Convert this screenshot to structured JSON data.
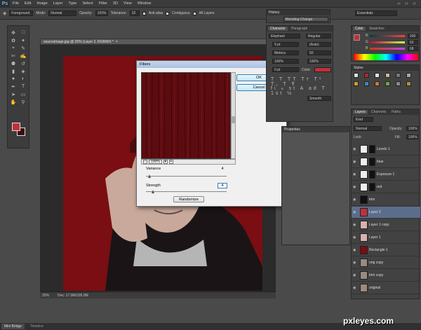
{
  "app": {
    "logo": "Ps"
  },
  "menu": [
    "File",
    "Edit",
    "Image",
    "Layer",
    "Type",
    "Select",
    "Filter",
    "3D",
    "View",
    "Window"
  ],
  "options": {
    "preset": "Foreground",
    "mode_label": "Mode:",
    "mode": "Normal",
    "opacity_label": "Opacity:",
    "opacity": "100%",
    "tolerance_label": "Tolerance:",
    "tolerance": "32",
    "antialias": "Anti-alias",
    "contiguous": "Contiguous",
    "all_layers": "All Layers",
    "workspace": "Essentials"
  },
  "document": {
    "tab": "sourceimage.jpg @ 25% (Layer 2, RGB/8#) *",
    "zoom": "25%",
    "doc_size": "Doc: 17.0M/105.0M"
  },
  "dialog": {
    "title": "Fibers",
    "ok": "OK",
    "cancel": "Cancel",
    "zoom": "100%",
    "variance_label": "Variance",
    "variance": "4",
    "strength_label": "Strength",
    "strength": "4",
    "randomize": "Randomize"
  },
  "history": {
    "title": "History",
    "item": "Blending Change"
  },
  "character": {
    "tabs": [
      "Character",
      "Paragraph"
    ],
    "font": "Elephant",
    "style": "Regular",
    "size": "9 pt",
    "leading": "(Auto)",
    "kerning": "Metrics",
    "tracking": "50",
    "scale_v": "100%",
    "scale_h": "100%",
    "baseline": "0 pt",
    "color_label": "Color:",
    "aa": "Smooth"
  },
  "properties": {
    "title": "Properties"
  },
  "color_panel": {
    "tabs": [
      "Color",
      "Swatches"
    ],
    "channels": [
      {
        "label": "R",
        "value": "200"
      },
      {
        "label": "G",
        "value": "62"
      },
      {
        "label": "B",
        "value": "68"
      }
    ]
  },
  "styles": {
    "title": "Styles"
  },
  "layers_panel": {
    "tabs": [
      "Layers",
      "Channels",
      "Paths"
    ],
    "kind": "Kind",
    "blend": "Normal",
    "opacity_label": "Opacity:",
    "opacity": "100%",
    "lock_label": "Lock:",
    "fill_label": "Fill:",
    "fill": "100%",
    "layers": [
      {
        "name": "Levels 1",
        "thumb": "#eeeeee",
        "mask": "#111111"
      },
      {
        "name": "blue",
        "thumb": "#eeeeee",
        "mask": "#111111"
      },
      {
        "name": "Exposure 1",
        "thumb": "#eeeeee",
        "mask": "#111111"
      },
      {
        "name": "red",
        "thumb": "#eeeeee",
        "mask": "#111111"
      },
      {
        "name": "trim",
        "thumb": "#111111",
        "mask": ""
      },
      {
        "name": "Layer 2",
        "thumb": "#c0303a",
        "mask": "",
        "selected": true
      },
      {
        "name": "Layer 1 copy",
        "thumb": "#d9b0b0",
        "mask": ""
      },
      {
        "name": "Layer 1",
        "thumb": "#d9b0b0",
        "mask": ""
      },
      {
        "name": "Rectangle 1",
        "thumb": "#7a0e12",
        "mask": ""
      },
      {
        "name": "orig copy",
        "thumb": "#9a8a80",
        "mask": ""
      },
      {
        "name": "trim copy",
        "thumb": "#9a8a80",
        "mask": ""
      },
      {
        "name": "original",
        "thumb": "#9a8a80",
        "mask": ""
      }
    ]
  },
  "bottom_tabs": [
    "Mini Bridge",
    "Timeline"
  ],
  "watermark": "pxleyes.com",
  "colors": {
    "foreground": "#c0303a",
    "background": "#400a10",
    "canvas_red": "#7a0e12",
    "accent_blue": "#5cb7ff"
  }
}
